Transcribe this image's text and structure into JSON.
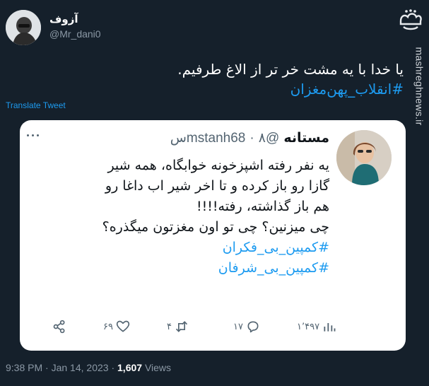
{
  "author": {
    "name": "آزوف",
    "handle": "@Mr_dani0"
  },
  "watermark": {
    "logo_text": "مشرق",
    "url": "mashreghnews.ir"
  },
  "tweet": {
    "text": "یا خدا با یه مشت خر تر از الاغ طرفیم.",
    "hashtag": "#انقلاب_پهن‌مغزان"
  },
  "translate_label": "Translate Tweet",
  "quote": {
    "name": "مستانه",
    "handle": "@mstanh68",
    "dot": "·",
    "time": "۸س",
    "lines": [
      "یه نفر رفته اشپزخونه خوابگاه، همه شیر",
      "گازا رو باز کرده و  تا اخر شیر اب داغا رو",
      "هم باز گذاشته، رفته!!!!",
      "چی میزنین؟ چی تو اون مغزتون میگذره؟"
    ],
    "hashtags": [
      "#کمپین_بی_فکران",
      "#کمپین_بی_شرفان"
    ],
    "actions": {
      "likes": "۶۹",
      "retweets": "۴",
      "replies": "۱۷",
      "views": "۱٬۴۹۷"
    }
  },
  "footer": {
    "time": "9:38 PM",
    "sep": "·",
    "date": "Jan 14, 2023",
    "sep2": "·",
    "views_count": "1,607",
    "views_label": "Views"
  }
}
